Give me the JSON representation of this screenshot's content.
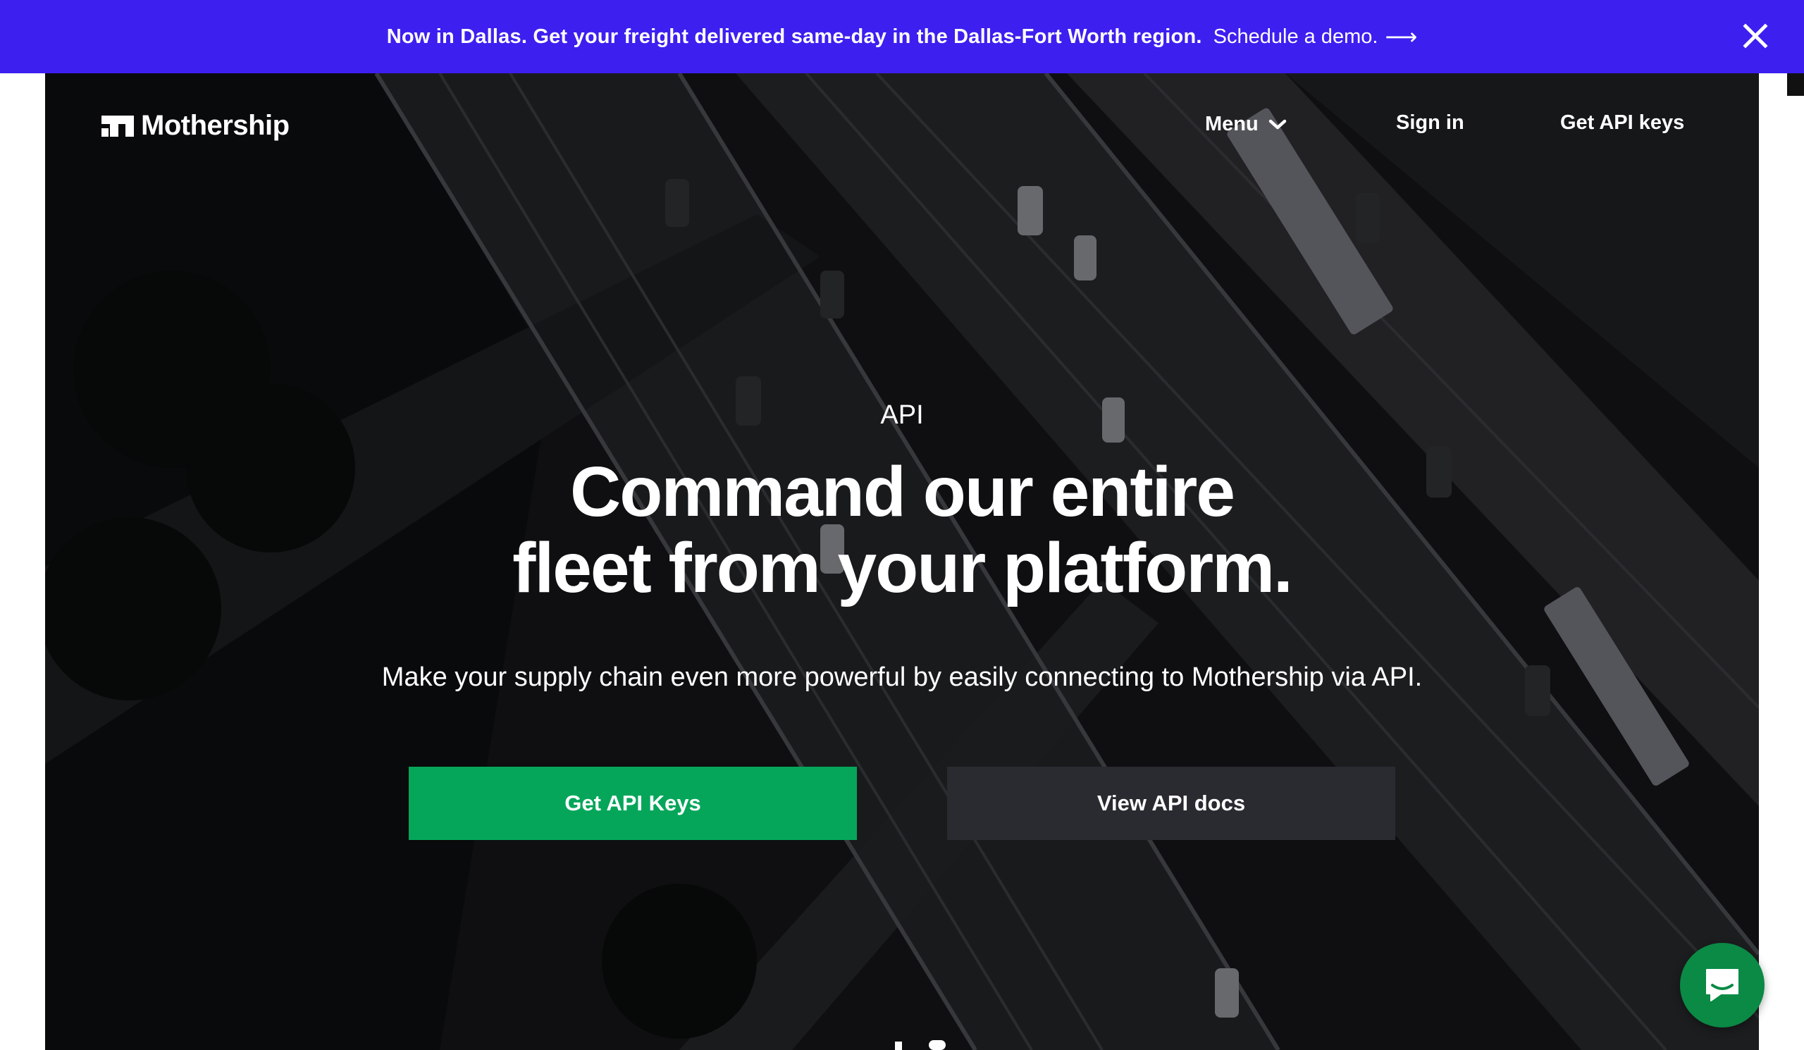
{
  "announcement": {
    "text": "Now in Dallas. Get your freight delivered same-day in the Dallas-Fort Worth region.",
    "link_label": "Schedule a demo.",
    "link_arrow_icon": "arrow-right-icon",
    "close_icon": "close-icon",
    "background": "#3d1ff0"
  },
  "nav": {
    "logo_text": "Mothership",
    "menu_label": "Menu",
    "menu_icon": "chevron-down-icon",
    "signin_label": "Sign in",
    "api_keys_label": "Get API keys"
  },
  "hero": {
    "eyebrow": "API",
    "headline_line1": "Command our entire",
    "headline_line2": "fleet from your platform.",
    "subhead": "Make your supply chain even more powerful by easily connecting to Mothership via API.",
    "primary_button": "Get API Keys",
    "secondary_button": "View API docs",
    "primary_color": "#05a65a",
    "secondary_color": "#2a2b30"
  },
  "chat": {
    "icon": "chat-bubble-icon",
    "color": "#0a8a45"
  }
}
